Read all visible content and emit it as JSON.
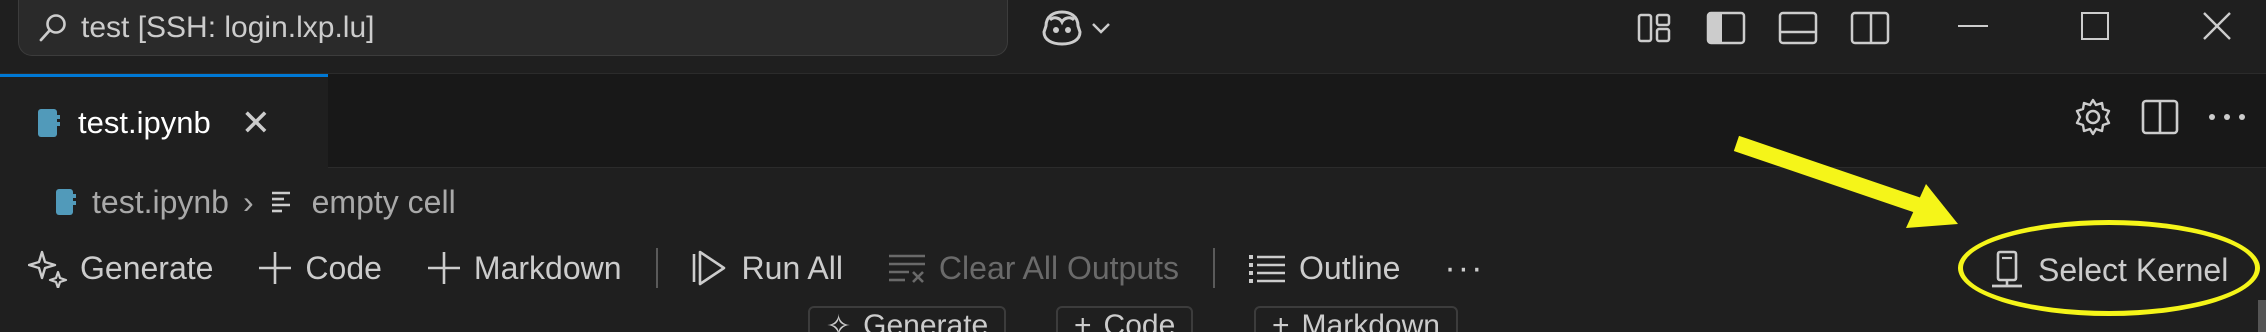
{
  "titlebar": {
    "search_text": "test [SSH: login.lxp.lu]",
    "icons": [
      "search-icon",
      "copilot-icon",
      "chevron-down-icon",
      "customize-layout-icon",
      "toggle-primary-sidebar-icon",
      "toggle-panel-icon",
      "toggle-secondary-sidebar-icon"
    ],
    "window_controls": [
      "minimize",
      "maximize",
      "close"
    ]
  },
  "tabs": [
    {
      "label": "test.ipynb",
      "active": true,
      "close_glyph": "✕"
    }
  ],
  "tab_actions": [
    "settings-icon",
    "split-editor-icon",
    "more-actions-icon"
  ],
  "breadcrumb": {
    "file": "test.ipynb",
    "separator": "›",
    "cell": "empty cell"
  },
  "notebook_toolbar": {
    "generate": "Generate",
    "code": "Code",
    "markdown": "Markdown",
    "run_all": "Run All",
    "clear_all_outputs": "Clear All Outputs",
    "outline": "Outline",
    "more": "···"
  },
  "kernel": {
    "label": "Select Kernel"
  },
  "cell_toolbar": {
    "generate": "Generate",
    "code": "Code",
    "markdown": "Markdown"
  },
  "colors": {
    "background": "#1f1f1f",
    "tab_bar": "#181818",
    "accent": "#0078d4",
    "annotation": "#f5f519",
    "notebook_icon": "#519aba"
  }
}
